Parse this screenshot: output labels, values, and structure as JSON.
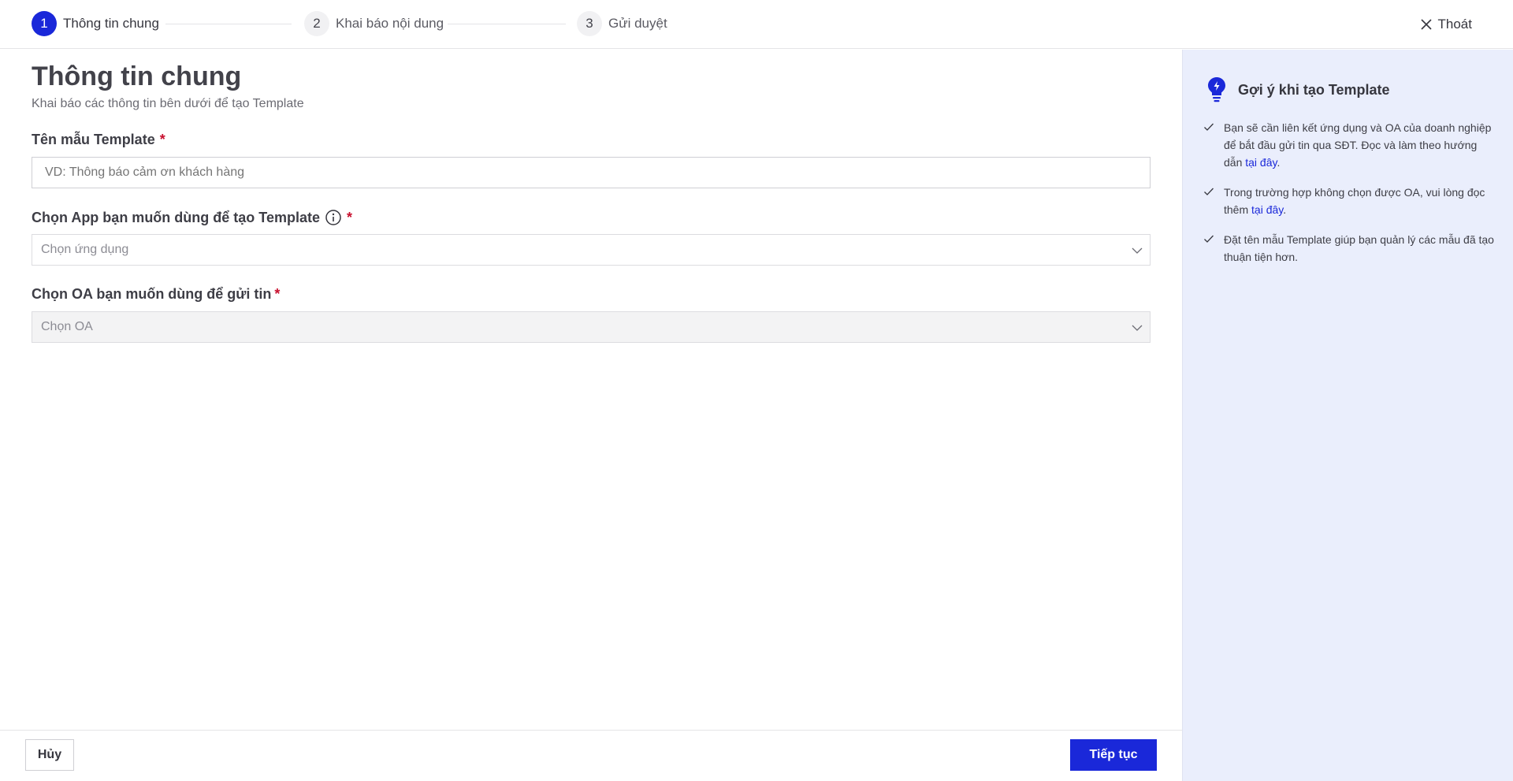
{
  "stepper": {
    "steps": [
      {
        "number": "1",
        "label": "Thông tin chung",
        "active": true
      },
      {
        "number": "2",
        "label": "Khai báo nội dung",
        "active": false
      },
      {
        "number": "3",
        "label": "Gửi duyệt",
        "active": false
      }
    ],
    "exit_label": "Thoát"
  },
  "main": {
    "title": "Thông tin chung",
    "subtitle": "Khai báo các thông tin bên dưới để tạo Template",
    "template_name": {
      "label": "Tên mẫu Template",
      "required_mark": "*",
      "placeholder": "VD: Thông báo cảm ơn khách hàng",
      "value": ""
    },
    "app_select": {
      "label": "Chọn App bạn muốn dùng để tạo Template",
      "required_mark": "*",
      "placeholder": "Chọn ứng dụng"
    },
    "oa_select": {
      "label": "Chọn OA bạn muốn dùng để gửi tin",
      "required_mark": "*",
      "placeholder": "Chọn OA",
      "disabled": true
    }
  },
  "footer": {
    "cancel_label": "Hủy",
    "next_label": "Tiếp tục"
  },
  "side_panel": {
    "title": "Gợi ý khi tạo Template",
    "tips": [
      {
        "text": "Bạn sẽ cần liên kết ứng dụng và OA của doanh nghiệp để bắt đầu gửi tin qua SĐT. Đọc và làm theo hướng dẫn ",
        "link": "tại đây",
        "suffix": "."
      },
      {
        "text": "Trong trường hợp không chọn được OA, vui lòng đọc thêm ",
        "link": "tại đây",
        "suffix": "."
      },
      {
        "text": "Đặt tên mẫu Template giúp bạn quản lý các mẫu đã tạo thuận tiện hơn.",
        "link": "",
        "suffix": ""
      }
    ]
  },
  "colors": {
    "primary": "#1a28d9",
    "required": "#c8102e",
    "side_bg": "#eaeefc"
  }
}
